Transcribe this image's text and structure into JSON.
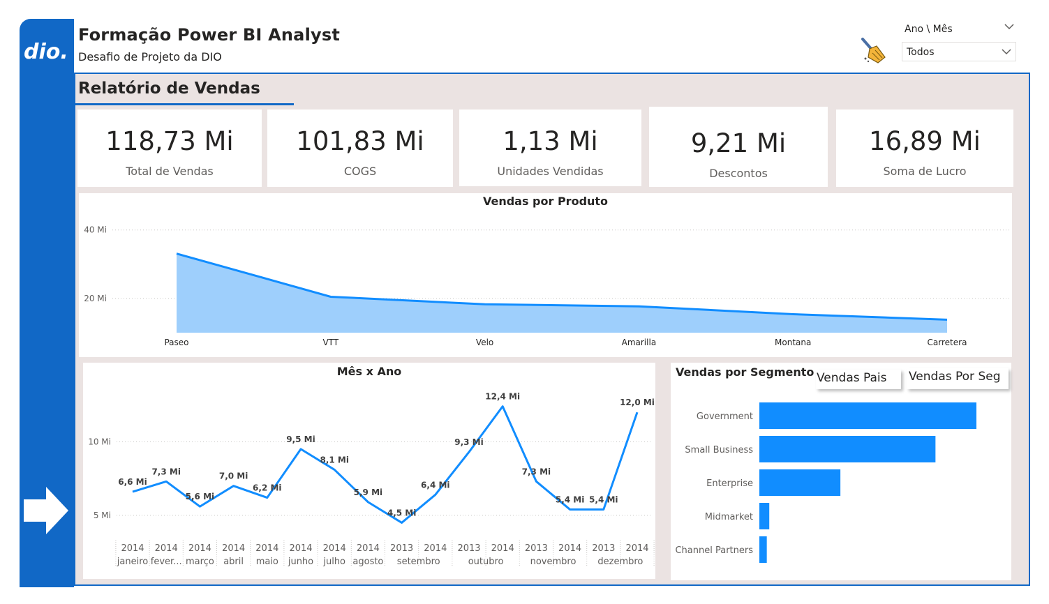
{
  "header": {
    "title": "Formação Power BI Analyst",
    "subtitle": "Desafio de Projeto da DIO",
    "logo_text": "dio."
  },
  "slicer": {
    "label": "Ano \\ Mês",
    "value": "Todos"
  },
  "report": {
    "title": "Relatório de Vendas"
  },
  "kpis": [
    {
      "value": "118,73 Mi",
      "label": "Total de Vendas"
    },
    {
      "value": "101,83 Mi",
      "label": "COGS"
    },
    {
      "value": "1,13 Mi",
      "label": "Unidades Vendidas"
    },
    {
      "value": "9,21 Mi",
      "label": "Descontos"
    },
    {
      "value": "16,89 Mi",
      "label": "Soma de Lucro"
    }
  ],
  "colors": {
    "accent": "#1168c6",
    "series": "#118dff",
    "area_fill": "#9ecffc",
    "panel_bg": "#ebe3e2"
  },
  "chart_data": [
    {
      "type": "area",
      "title": "Vendas por Produto",
      "categories": [
        "Paseo",
        "VTT",
        "Velo",
        "Amarilla",
        "Montana",
        "Carretera"
      ],
      "values": [
        33.1,
        20.5,
        18.3,
        17.7,
        15.4,
        13.8
      ],
      "yticks": [
        "40 Mi",
        "20 Mi"
      ],
      "ytick_values": [
        40,
        20
      ],
      "ylim": [
        10,
        43
      ],
      "grid": true
    },
    {
      "type": "line",
      "title": "Mês x Ano",
      "categories": [
        {
          "year": "2014",
          "month": "janeiro"
        },
        {
          "year": "2014",
          "month": "fever..."
        },
        {
          "year": "2014",
          "month": "março"
        },
        {
          "year": "2014",
          "month": "abril"
        },
        {
          "year": "2014",
          "month": "maio"
        },
        {
          "year": "2014",
          "month": "junho"
        },
        {
          "year": "2014",
          "month": "julho"
        },
        {
          "year": "2014",
          "month": "agosto"
        },
        {
          "year": "2013",
          "month": "setembro"
        },
        {
          "year": "2014",
          "month": ""
        },
        {
          "year": "2013",
          "month": "outubro"
        },
        {
          "year": "2014",
          "month": ""
        },
        {
          "year": "2013",
          "month": "novembro"
        },
        {
          "year": "2014",
          "month": ""
        },
        {
          "year": "2013",
          "month": "dezembro"
        },
        {
          "year": "2014",
          "month": ""
        }
      ],
      "values": [
        6.6,
        7.3,
        5.6,
        7.0,
        6.2,
        9.5,
        8.1,
        5.9,
        4.5,
        6.4,
        9.3,
        12.4,
        7.3,
        5.4,
        5.4,
        12.0
      ],
      "data_labels": [
        "6,6 Mi",
        "7,3 Mi",
        "5,6 Mi",
        "7,0 Mi",
        "6,2 Mi",
        "9,5 Mi",
        "8,1 Mi",
        "5,9 Mi",
        "4,5 Mi",
        "6,4 Mi",
        "9,3 Mi",
        "12,4 Mi",
        "7,3 Mi",
        "5,4 Mi",
        "5,4 Mi",
        "12,0 Mi"
      ],
      "yticks": [
        "10 Mi",
        "5 Mi"
      ],
      "ytick_values": [
        10,
        5
      ],
      "ylim": [
        4,
        13
      ],
      "grid": true
    },
    {
      "type": "bar",
      "orientation": "horizontal",
      "title": "Vendas por Segmento",
      "categories": [
        "Government",
        "Small Business",
        "Enterprise",
        "Midmarket",
        "Channel Partners"
      ],
      "values": [
        52.5,
        42.6,
        19.6,
        2.4,
        1.8
      ]
    }
  ],
  "buttons": {
    "pais": "Vendas Pais",
    "seg": "Vendas Por Seg"
  },
  "icons": {
    "logo": "dio-logo",
    "nav": "arrow-right-icon",
    "clear": "broom-icon",
    "dropdown": "chevron-down-icon"
  }
}
